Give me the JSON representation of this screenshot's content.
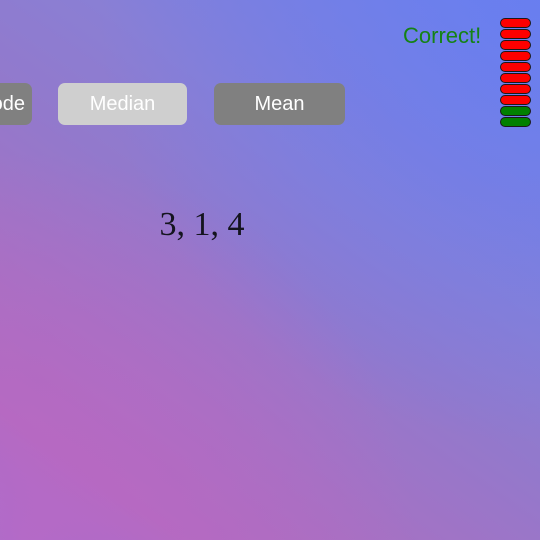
{
  "feedback": {
    "text": "Correct!",
    "color": "#158215"
  },
  "buttons": [
    {
      "id": "mode",
      "label": "Mode",
      "state": "normal",
      "bg": "#808080"
    },
    {
      "id": "median",
      "label": "Median",
      "state": "highlighted",
      "bg": "#cfcfcf"
    },
    {
      "id": "mean",
      "label": "Mean",
      "state": "normal",
      "bg": "#808080"
    }
  ],
  "problem": {
    "numbers": "3, 1, 4"
  },
  "progress": {
    "total_segments": 10,
    "segments": [
      "red",
      "red",
      "red",
      "red",
      "red",
      "red",
      "red",
      "red",
      "green",
      "green"
    ],
    "red_color": "#fe0000",
    "green_color": "#018000",
    "green_count": 2,
    "red_count": 8
  },
  "background": {
    "top_right": "#6f82ea",
    "center": "#9279cc",
    "bottom_left": "#b06cbf"
  }
}
